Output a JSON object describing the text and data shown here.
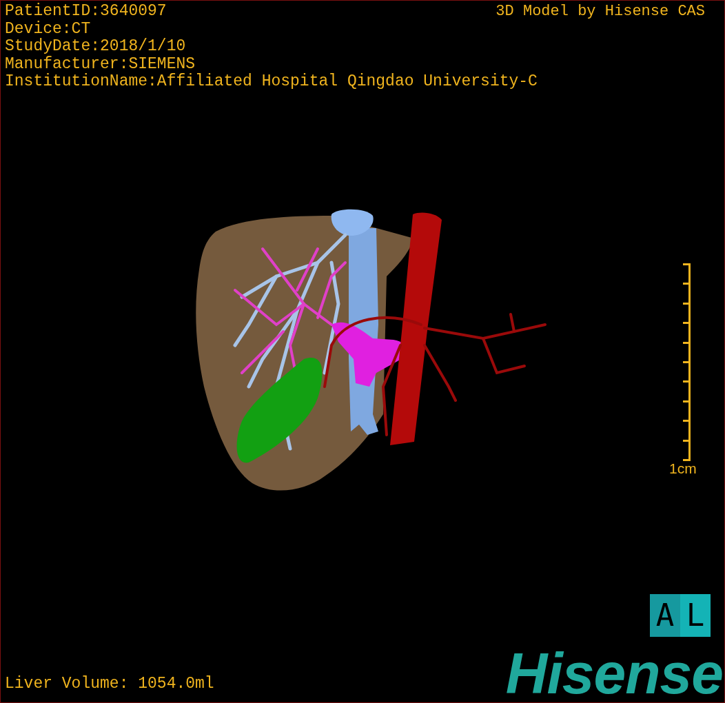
{
  "overlay": {
    "patient_info": [
      "PatientID:3640097",
      "Device:CT",
      "StudyDate:2018/1/10",
      "Manufacturer:SIEMENS",
      "InstitutionName:Affiliated Hospital Qingdao University-C"
    ],
    "credit": "3D Model by Hisense CAS",
    "volume": "Liver Volume: 1054.0ml"
  },
  "scale_bar": {
    "label": "1cm"
  },
  "orientation": {
    "letters": [
      "A",
      "L"
    ]
  },
  "logo": {
    "text": "Hisense"
  }
}
